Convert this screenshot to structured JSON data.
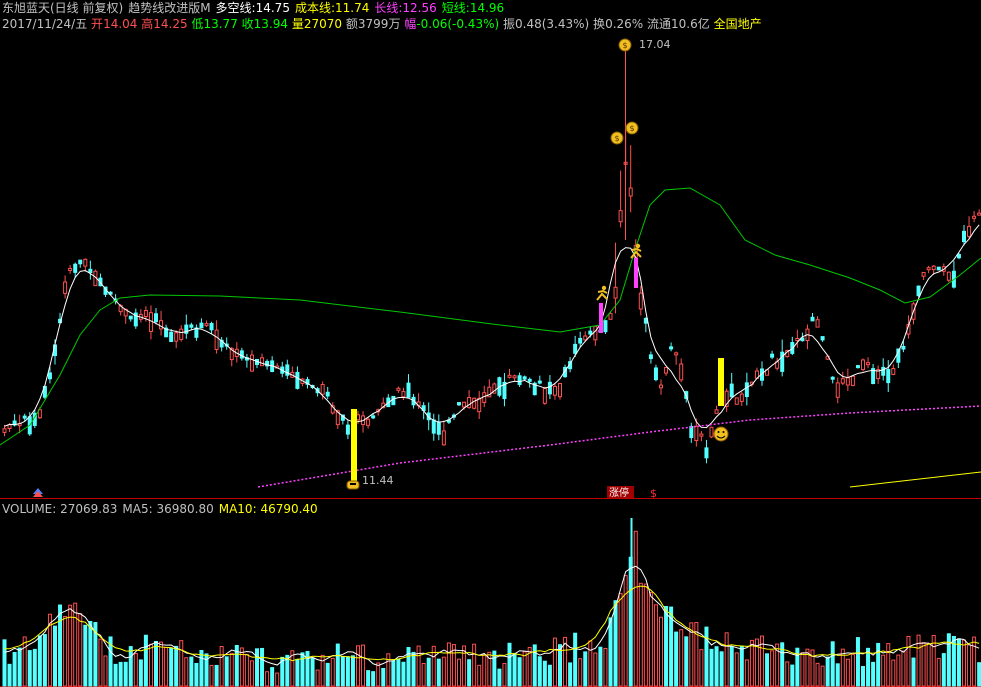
{
  "header": {
    "stock_name": "东旭蓝天(日线 前复权)",
    "indicator_name": "趋势线改进版M",
    "duokong_label": "多空线:",
    "duokong_value": "14.75",
    "chengben_label": "成本线:",
    "chengben_value": "11.74",
    "changxian_label": "长线:",
    "changxian_value": "12.56",
    "duanxian_label": "短线:",
    "duanxian_value": "14.96"
  },
  "quote": {
    "date": "2017/11/24/五",
    "open_label": "开",
    "open": "14.04",
    "high_label": "高",
    "high": "14.25",
    "low_label": "低",
    "low": "13.77",
    "close_label": "收",
    "close": "13.94",
    "volume_label": "量",
    "volume": "27070",
    "amount_label": "额",
    "amount": "3799万",
    "change_label": "幅",
    "change": "-0.06(-0.43%)",
    "amplitude_label": "振",
    "amplitude": "0.48(3.43%)",
    "turnover_label": "换",
    "turnover": "0.26%",
    "float_label": "流通",
    "float": "10.6亿",
    "sector": "全国地产"
  },
  "volume_header": {
    "volume_label": "VOLUME:",
    "volume": "27069.83",
    "ma5_label": "MA5:",
    "ma5": "36980.80",
    "ma10_label": "MA10:",
    "ma10": "46790.40"
  },
  "annotations": {
    "peak_price": "17.04",
    "low_price": "11.44",
    "limit_up_label": "涨停",
    "dollar_mark": "$"
  },
  "icons": [
    "money-bag-icon",
    "runner-icon",
    "smiley-icon",
    "bottom-marker-icon",
    "up-arrow-icon"
  ],
  "colors": {
    "up": "#ff5050",
    "down": "#54ffff",
    "ma_white": "#ffffff",
    "long_green": "#00c800",
    "cost_magenta": "#ff40ff",
    "signal_yellow": "#ffff00",
    "border_red": "#c00000",
    "header_yellow": "#ffff00",
    "header_magenta": "#ff40ff",
    "header_green": "#00ff00"
  }
}
